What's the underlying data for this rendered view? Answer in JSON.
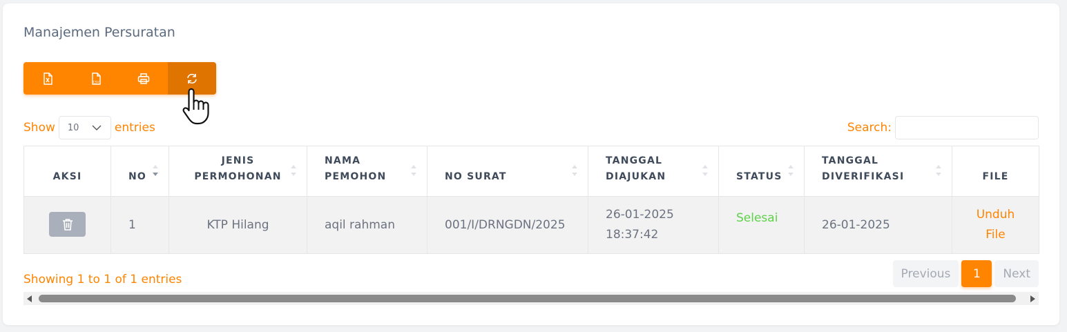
{
  "page_title": "Manajemen Persuratan",
  "toolbar": {
    "buttons": [
      {
        "icon": "excel-file-icon"
      },
      {
        "icon": "csv-file-icon"
      },
      {
        "icon": "printer-icon"
      },
      {
        "icon": "refresh-icon",
        "active": true
      }
    ],
    "accent": "#ff8400"
  },
  "length_control": {
    "show_label": "Show",
    "value": "10",
    "entries_label": "entries"
  },
  "search": {
    "label": "Search:",
    "value": ""
  },
  "table": {
    "columns": [
      "AKSI",
      "NO",
      "JENIS PERMOHONAN",
      "NAMA PEMOHON",
      "NO SURAT",
      "TANGGAL DIAJUKAN",
      "STATUS",
      "TANGGAL DIVERIFIKASI",
      "FILE"
    ],
    "columns_lines": [
      [
        "AKSI"
      ],
      [
        "NO"
      ],
      [
        "JENIS",
        "PERMOHONAN"
      ],
      [
        "NAMA",
        "PEMOHON"
      ],
      [
        "NO SURAT"
      ],
      [
        "TANGGAL",
        "DIAJUKAN"
      ],
      [
        "STATUS"
      ],
      [
        "TANGGAL",
        "DIVERIFIKASI"
      ],
      [
        "FILE"
      ]
    ],
    "rows": [
      {
        "no": "1",
        "jenis_permohonan": "KTP Hilang",
        "nama_pemohon": "aqil rahman",
        "no_surat": "001/I/DRNGDN/2025",
        "tanggal_diajukan_date": "26-01-2025",
        "tanggal_diajukan_time": "18:37:42",
        "status": "Selesai",
        "tanggal_diverifikasi": "26-01-2025",
        "file_line1": "Unduh",
        "file_line2": "File"
      }
    ]
  },
  "footer": {
    "info": "Showing 1 to 1 of 1 entries",
    "pagination": {
      "previous": "Previous",
      "current": "1",
      "next": "Next"
    }
  },
  "colors": {
    "status_done": "#5ed14a",
    "delete_button": "#a9b0bb"
  }
}
